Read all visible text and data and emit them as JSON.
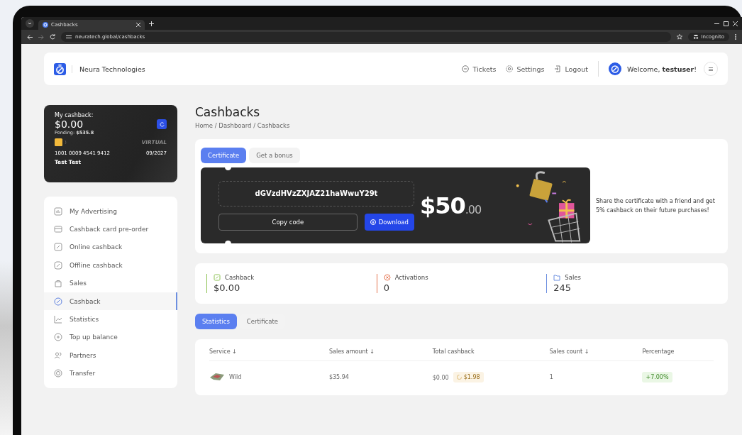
{
  "browser": {
    "tab_title": "Cashbacks",
    "url": "neuratech.global/cashbacks",
    "profile": "Incognito"
  },
  "header": {
    "brand": "Neura Technologies",
    "nav": [
      {
        "label": "Tickets"
      },
      {
        "label": "Settings"
      },
      {
        "label": "Logout"
      }
    ],
    "welcome": "Welcome, **testuser**!"
  },
  "card": {
    "label": "My cashback:",
    "balance": "$0.00",
    "pending": "Pending: **$535.8**",
    "type": "VIRTUAL",
    "number": "1001 0009 4541 9412",
    "expiry": "09/2027",
    "holder": "Test Test"
  },
  "sidebar": {
    "items": [
      {
        "label": "My Advertising",
        "selected": false
      },
      {
        "label": "Cashback card pre-order",
        "selected": false
      },
      {
        "label": "Online cashback",
        "selected": false
      },
      {
        "label": "Offline cashback",
        "selected": false
      },
      {
        "label": "Sales",
        "selected": false
      },
      {
        "label": "Cashback",
        "selected": true
      },
      {
        "label": "Statistics",
        "selected": false
      },
      {
        "label": "Top up balance",
        "selected": false
      },
      {
        "label": "Partners",
        "selected": false
      },
      {
        "label": "Transfer",
        "selected": false
      }
    ]
  },
  "page": {
    "title": "Cashbacks",
    "breadcrumbs": "Home / Dashboard / Cashbacks"
  },
  "certificate": {
    "tabs": [
      {
        "label": "Certificate",
        "selected": true
      },
      {
        "label": "Get a bonus",
        "selected": false
      }
    ],
    "code": "dGVzdHVzZXJAZ21haWwuY29t",
    "copy_button": "Copy code",
    "download_button": "Download",
    "amount": "$50",
    "cents": ".00",
    "description": "Share the certificate with a friend and get 5% cashback on their future purchases!"
  },
  "stats": [
    {
      "label": "Cashback",
      "value": "$0.00",
      "color": "#8cc152"
    },
    {
      "label": "Activations",
      "value": "0",
      "color": "#e5734f"
    },
    {
      "label": "Sales",
      "value": "245",
      "color": "#6d8fe0"
    }
  ],
  "report_tabs": [
    {
      "label": "Statistics",
      "selected": true
    },
    {
      "label": "Certificate",
      "selected": false
    }
  ],
  "table": {
    "columns": [
      "Service ↓",
      "Sales amount ↓",
      "Total cashback",
      "Sales count ↓",
      "Percentage"
    ],
    "rows": [
      {
        "service": "Wild",
        "sales_amount": "$35.94",
        "total_cashback": "$0.00",
        "pending": "$1.98",
        "sales_count": "1",
        "percentage": "+7.00%"
      }
    ]
  }
}
